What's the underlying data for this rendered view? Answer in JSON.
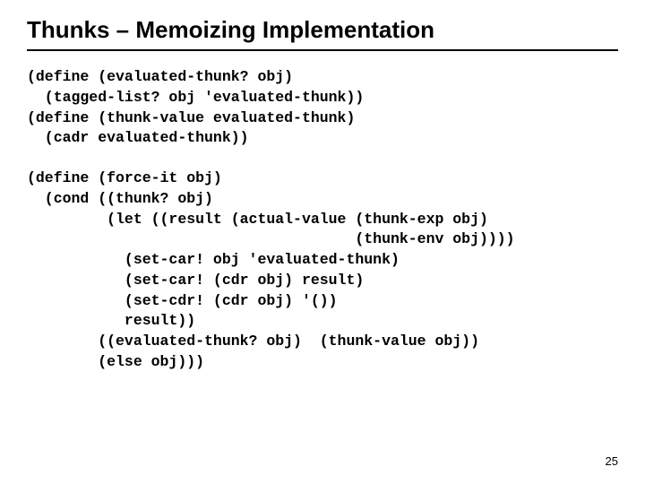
{
  "title": "Thunks – Memoizing Implementation",
  "code_block1": "(define (evaluated-thunk? obj)\n  (tagged-list? obj 'evaluated-thunk))\n(define (thunk-value evaluated-thunk)\n  (cadr evaluated-thunk))",
  "code_block2": "(define (force-it obj)\n  (cond ((thunk? obj)\n         (let ((result (actual-value (thunk-exp obj)\n                                     (thunk-env obj))))\n           (set-car! obj 'evaluated-thunk)\n           (set-car! (cdr obj) result)\n           (set-cdr! (cdr obj) '())\n           result))\n        ((evaluated-thunk? obj)  (thunk-value obj))\n        (else obj)))",
  "page_number": "25"
}
